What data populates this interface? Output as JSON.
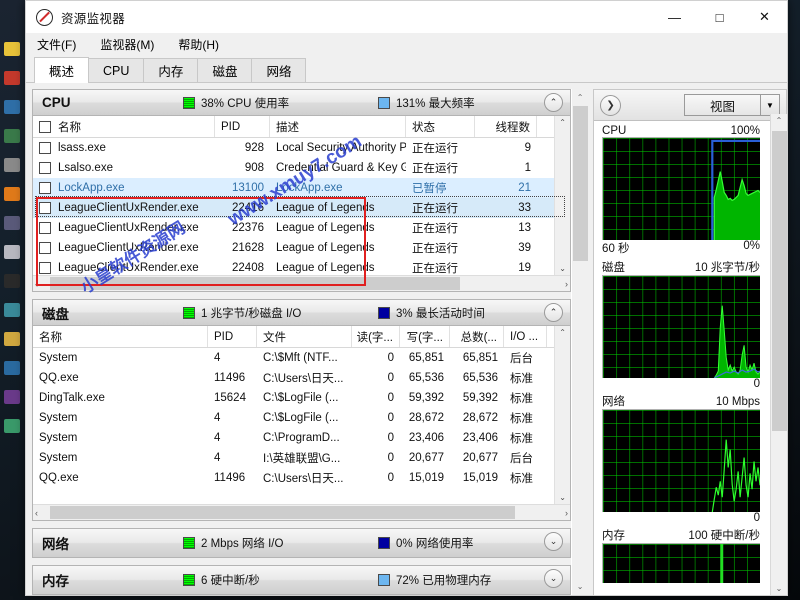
{
  "window": {
    "title": "资源监视器",
    "app_icon": "no-entry-icon",
    "minimize": "—",
    "maximize": "□",
    "close": "✕"
  },
  "menu": {
    "items": [
      {
        "label": "文件(F)",
        "name": "menu-file"
      },
      {
        "label": "监视器(M)",
        "name": "menu-monitor"
      },
      {
        "label": "帮助(H)",
        "name": "menu-help"
      }
    ]
  },
  "tabs": [
    {
      "label": "概述",
      "active": true
    },
    {
      "label": "CPU",
      "active": false
    },
    {
      "label": "内存",
      "active": false
    },
    {
      "label": "磁盘",
      "active": false
    },
    {
      "label": "网络",
      "active": false
    }
  ],
  "cpu_panel": {
    "title": "CPU",
    "stat1": "38% CPU 使用率",
    "stat2": "131% 最大频率",
    "collapse_glyph": "⌃",
    "columns": [
      "名称",
      "PID",
      "描述",
      "状态",
      "线程数"
    ],
    "rows": [
      {
        "name": "lsass.exe",
        "pid": "928",
        "desc": "Local Security Authority Pr...",
        "status": "正在运行",
        "threads": "9",
        "state": "normal"
      },
      {
        "name": "Lsalso.exe",
        "pid": "908",
        "desc": "Credential Guard & Key Gu...",
        "status": "正在运行",
        "threads": "1",
        "state": "normal"
      },
      {
        "name": "LockApp.exe",
        "pid": "13100",
        "desc": "LockApp.exe",
        "status": "已暂停",
        "threads": "21",
        "state": "suspended"
      },
      {
        "name": "LeagueClientUxRender.exe",
        "pid": "22416",
        "desc": "League of Legends",
        "status": "正在运行",
        "threads": "33",
        "state": "selected"
      },
      {
        "name": "LeagueClientUxRender.exe",
        "pid": "22376",
        "desc": "League of Legends",
        "status": "正在运行",
        "threads": "13",
        "state": "normal"
      },
      {
        "name": "LeagueClientUxRender.exe",
        "pid": "21628",
        "desc": "League of Legends",
        "status": "正在运行",
        "threads": "39",
        "state": "normal"
      },
      {
        "name": "LeagueClientUxRender.exe",
        "pid": "22408",
        "desc": "League of Legends",
        "status": "正在运行",
        "threads": "19",
        "state": "normal"
      }
    ]
  },
  "disk_panel": {
    "title": "磁盘",
    "stat1": "1 兆字节/秒磁盘 I/O",
    "stat2": "3% 最长活动时间",
    "collapse_glyph": "⌃",
    "columns": [
      "名称",
      "PID",
      "文件",
      "读(字...",
      "写(字...",
      "总数(...",
      "I/O ..."
    ],
    "rows": [
      {
        "name": "System",
        "pid": "4",
        "file": "C:\\$Mft (NTF...",
        "read": "0",
        "write": "65,851",
        "total": "65,851",
        "io": "后台"
      },
      {
        "name": "QQ.exe",
        "pid": "11496",
        "file": "C:\\Users\\日天...",
        "read": "0",
        "write": "65,536",
        "total": "65,536",
        "io": "标准"
      },
      {
        "name": "DingTalk.exe",
        "pid": "15624",
        "file": "C:\\$LogFile (...",
        "read": "0",
        "write": "59,392",
        "total": "59,392",
        "io": "标准"
      },
      {
        "name": "System",
        "pid": "4",
        "file": "C:\\$LogFile (...",
        "read": "0",
        "write": "28,672",
        "total": "28,672",
        "io": "标准"
      },
      {
        "name": "System",
        "pid": "4",
        "file": "C:\\ProgramD...",
        "read": "0",
        "write": "23,406",
        "total": "23,406",
        "io": "标准"
      },
      {
        "name": "System",
        "pid": "4",
        "file": "I:\\英雄联盟\\G...",
        "read": "0",
        "write": "20,677",
        "total": "20,677",
        "io": "后台"
      },
      {
        "name": "QQ.exe",
        "pid": "11496",
        "file": "C:\\Users\\日天...",
        "read": "0",
        "write": "15,019",
        "total": "15,019",
        "io": "标准"
      }
    ]
  },
  "network_panel": {
    "title": "网络",
    "stat1": "2 Mbps 网络 I/O",
    "stat2": "0% 网络使用率",
    "collapse_glyph": "⌄"
  },
  "memory_panel": {
    "title": "内存",
    "stat1": "6 硬中断/秒",
    "stat2": "72% 已用物理内存",
    "collapse_glyph": "⌄"
  },
  "right_pane": {
    "expand_glyph": "❯",
    "view_label": "视图",
    "view_arrow": "▼",
    "graphs": [
      {
        "title": "CPU",
        "max": "100%",
        "min": "0%",
        "time": "60 秒",
        "type": "cpu"
      },
      {
        "title": "磁盘",
        "max": "10 兆字节/秒",
        "min": "0",
        "time": "",
        "type": "disk"
      },
      {
        "title": "网络",
        "max": "10 Mbps",
        "min": "0",
        "time": "",
        "type": "network"
      },
      {
        "title": "内存",
        "max": "100 硬中断/秒",
        "min": "",
        "time": "",
        "type": "memory"
      }
    ]
  },
  "watermark": {
    "line1": "小皇软件资源网",
    "line2": "www.xmuy7.com"
  },
  "colors": {
    "accent_green": "#00c000",
    "accent_blue": "#2a6fd0",
    "suspended_text": "#2f6fa8",
    "annotation_red": "#e02020"
  }
}
